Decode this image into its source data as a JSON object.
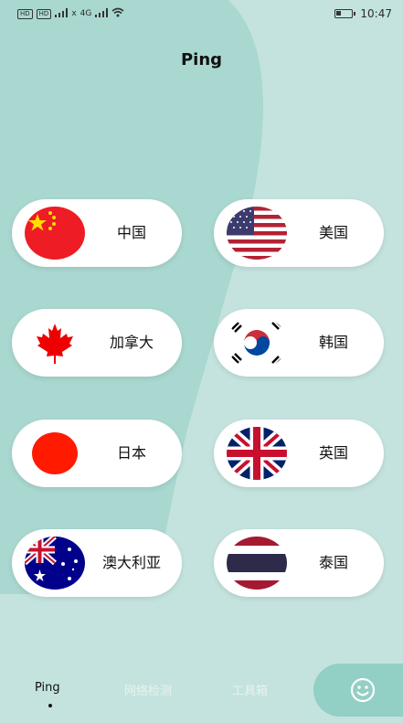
{
  "status_bar": {
    "carrier_badges": [
      "HD",
      "HD"
    ],
    "network_4g": "4G",
    "network_x": "x",
    "time": "10:47",
    "battery_level": 0.35
  },
  "page": {
    "title": "Ping"
  },
  "countries": [
    {
      "label": "中国",
      "flag": "china-flag"
    },
    {
      "label": "美国",
      "flag": "usa-flag"
    },
    {
      "label": "加拿大",
      "flag": "canada-flag"
    },
    {
      "label": "韩国",
      "flag": "korea-flag"
    },
    {
      "label": "日本",
      "flag": "japan-flag"
    },
    {
      "label": "英国",
      "flag": "uk-flag"
    },
    {
      "label": "澳大利亚",
      "flag": "australia-flag"
    },
    {
      "label": "泰国",
      "flag": "thailand-flag"
    }
  ],
  "bottom_nav": {
    "tabs": [
      {
        "label": "Ping",
        "active": true
      },
      {
        "label": "网络检测",
        "active": false
      },
      {
        "label": "工具箱",
        "active": false
      }
    ],
    "fab_icon": "smiley-icon"
  },
  "colors": {
    "background": "#c4e3de",
    "shape": "#a9d8d0",
    "fab": "#92cfc5",
    "card": "#ffffff"
  }
}
